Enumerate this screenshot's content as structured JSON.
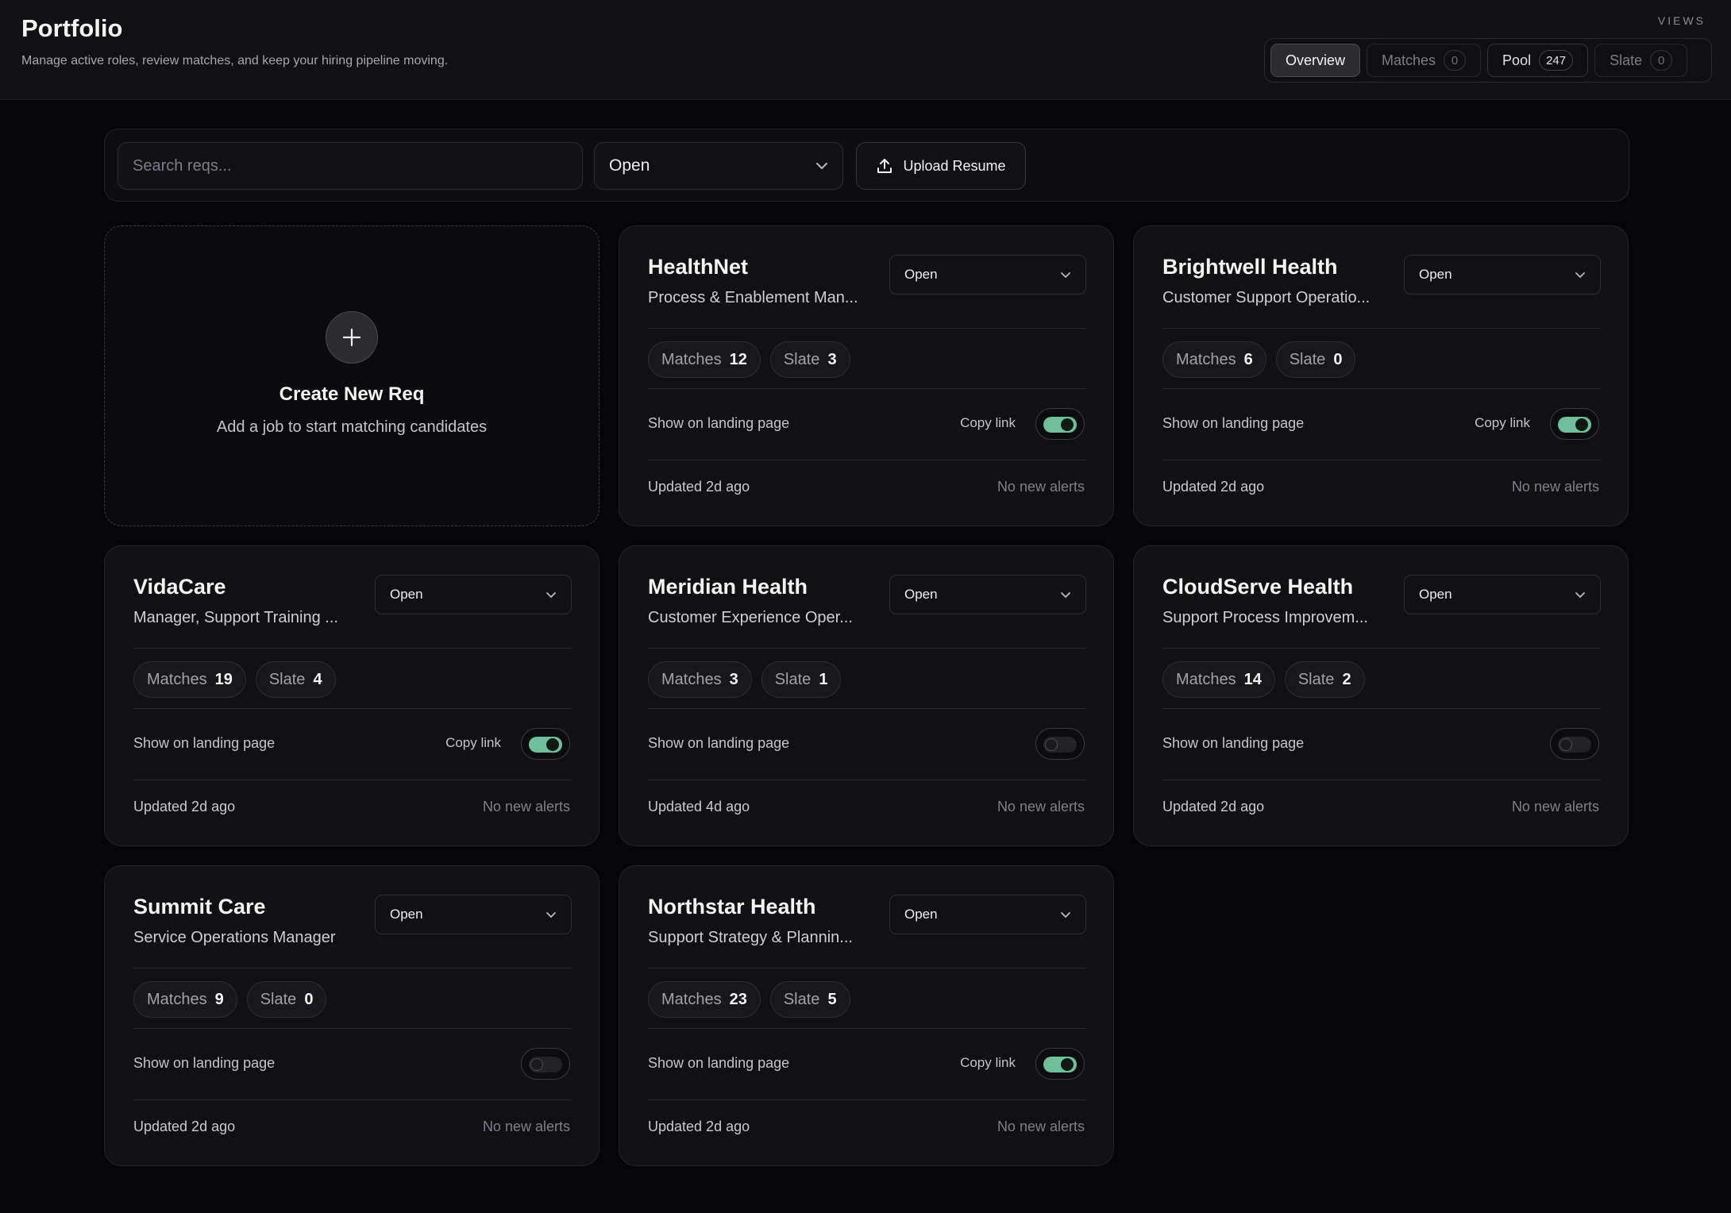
{
  "header": {
    "title": "Portfolio",
    "subtitle": "Manage active roles, review matches, and keep your hiring pipeline moving.",
    "views_label": "VIEWS",
    "views": [
      {
        "label": "Overview",
        "count": null,
        "active": true
      },
      {
        "label": "Matches",
        "count": "0",
        "active": false
      },
      {
        "label": "Pool",
        "count": "247",
        "active": false
      },
      {
        "label": "Slate",
        "count": "0",
        "active": false
      }
    ]
  },
  "toolbar": {
    "search_placeholder": "Search reqs...",
    "status_value": "Open",
    "upload_label": "Upload Resume"
  },
  "create_card": {
    "title": "Create New Req",
    "subtitle": "Add a job to start matching candidates"
  },
  "labels": {
    "matches": "Matches",
    "slate": "Slate",
    "show_on_landing": "Show on landing page",
    "copy_link": "Copy link"
  },
  "reqs": [
    {
      "company": "HealthNet",
      "role": "Process & Enablement Man...",
      "status": "Open",
      "matches": "12",
      "slate": "3",
      "landing": true,
      "updated": "Updated 2d ago",
      "alerts": "No new alerts"
    },
    {
      "company": "Brightwell Health",
      "role": "Customer Support Operatio...",
      "status": "Open",
      "matches": "6",
      "slate": "0",
      "landing": true,
      "updated": "Updated 2d ago",
      "alerts": "No new alerts"
    },
    {
      "company": "VidaCare",
      "role": "Manager, Support Training ...",
      "status": "Open",
      "matches": "19",
      "slate": "4",
      "landing": true,
      "updated": "Updated 2d ago",
      "alerts": "No new alerts"
    },
    {
      "company": "Meridian Health",
      "role": "Customer Experience Oper...",
      "status": "Open",
      "matches": "3",
      "slate": "1",
      "landing": false,
      "updated": "Updated 4d ago",
      "alerts": "No new alerts"
    },
    {
      "company": "CloudServe Health",
      "role": "Support Process Improvem...",
      "status": "Open",
      "matches": "14",
      "slate": "2",
      "landing": false,
      "updated": "Updated 2d ago",
      "alerts": "No new alerts"
    },
    {
      "company": "Summit Care",
      "role": "Service Operations Manager",
      "status": "Open",
      "matches": "9",
      "slate": "0",
      "landing": false,
      "updated": "Updated 2d ago",
      "alerts": "No new alerts"
    },
    {
      "company": "Northstar Health",
      "role": "Support Strategy & Plannin...",
      "status": "Open",
      "matches": "23",
      "slate": "5",
      "landing": true,
      "updated": "Updated 2d ago",
      "alerts": "No new alerts"
    }
  ],
  "colors": {
    "background": "#060608",
    "card": "#111113",
    "toggle_on": "#6fc09a"
  },
  "icons": {
    "select": "chevron-down-icon",
    "upload": "upload-icon",
    "create": "plus-icon"
  }
}
